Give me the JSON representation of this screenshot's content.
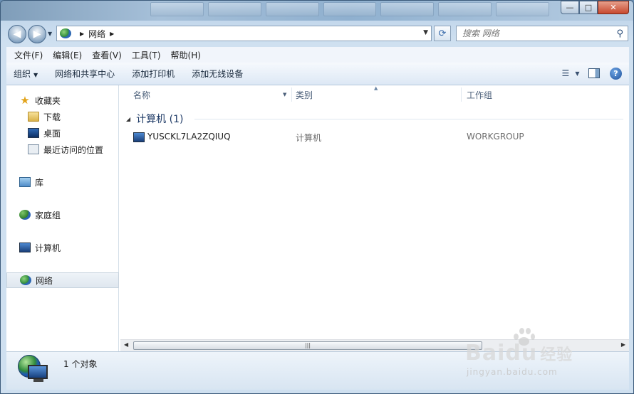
{
  "window": {
    "controls": {
      "minimize": "—",
      "maximize": "□",
      "close": "✕"
    }
  },
  "nav": {
    "address_crumb": "网络",
    "search_placeholder": "搜索 网络"
  },
  "menu": [
    "文件(F)",
    "编辑(E)",
    "查看(V)",
    "工具(T)",
    "帮助(H)"
  ],
  "commands": {
    "organize": "组织",
    "network_center": "网络和共享中心",
    "add_printer": "添加打印机",
    "add_wireless": "添加无线设备"
  },
  "sidebar": {
    "favorites": "收藏夹",
    "downloads": "下载",
    "desktop": "桌面",
    "recent": "最近访问的位置",
    "libraries": "库",
    "homegroup": "家庭组",
    "computer": "计算机",
    "network": "网络"
  },
  "columns": {
    "name": "名称",
    "type": "类别",
    "workgroup": "工作组"
  },
  "group": {
    "label": "计算机 (1)"
  },
  "rows": [
    {
      "name": "YUSCKL7LA2ZQIUQ",
      "type": "计算机",
      "workgroup": "WORKGROUP"
    }
  ],
  "status": {
    "text": "1 个对象"
  },
  "watermark": {
    "brand": "Bai",
    "brand2": "du",
    "brand_cn": "经验",
    "url": "jingyan.baidu.com"
  }
}
